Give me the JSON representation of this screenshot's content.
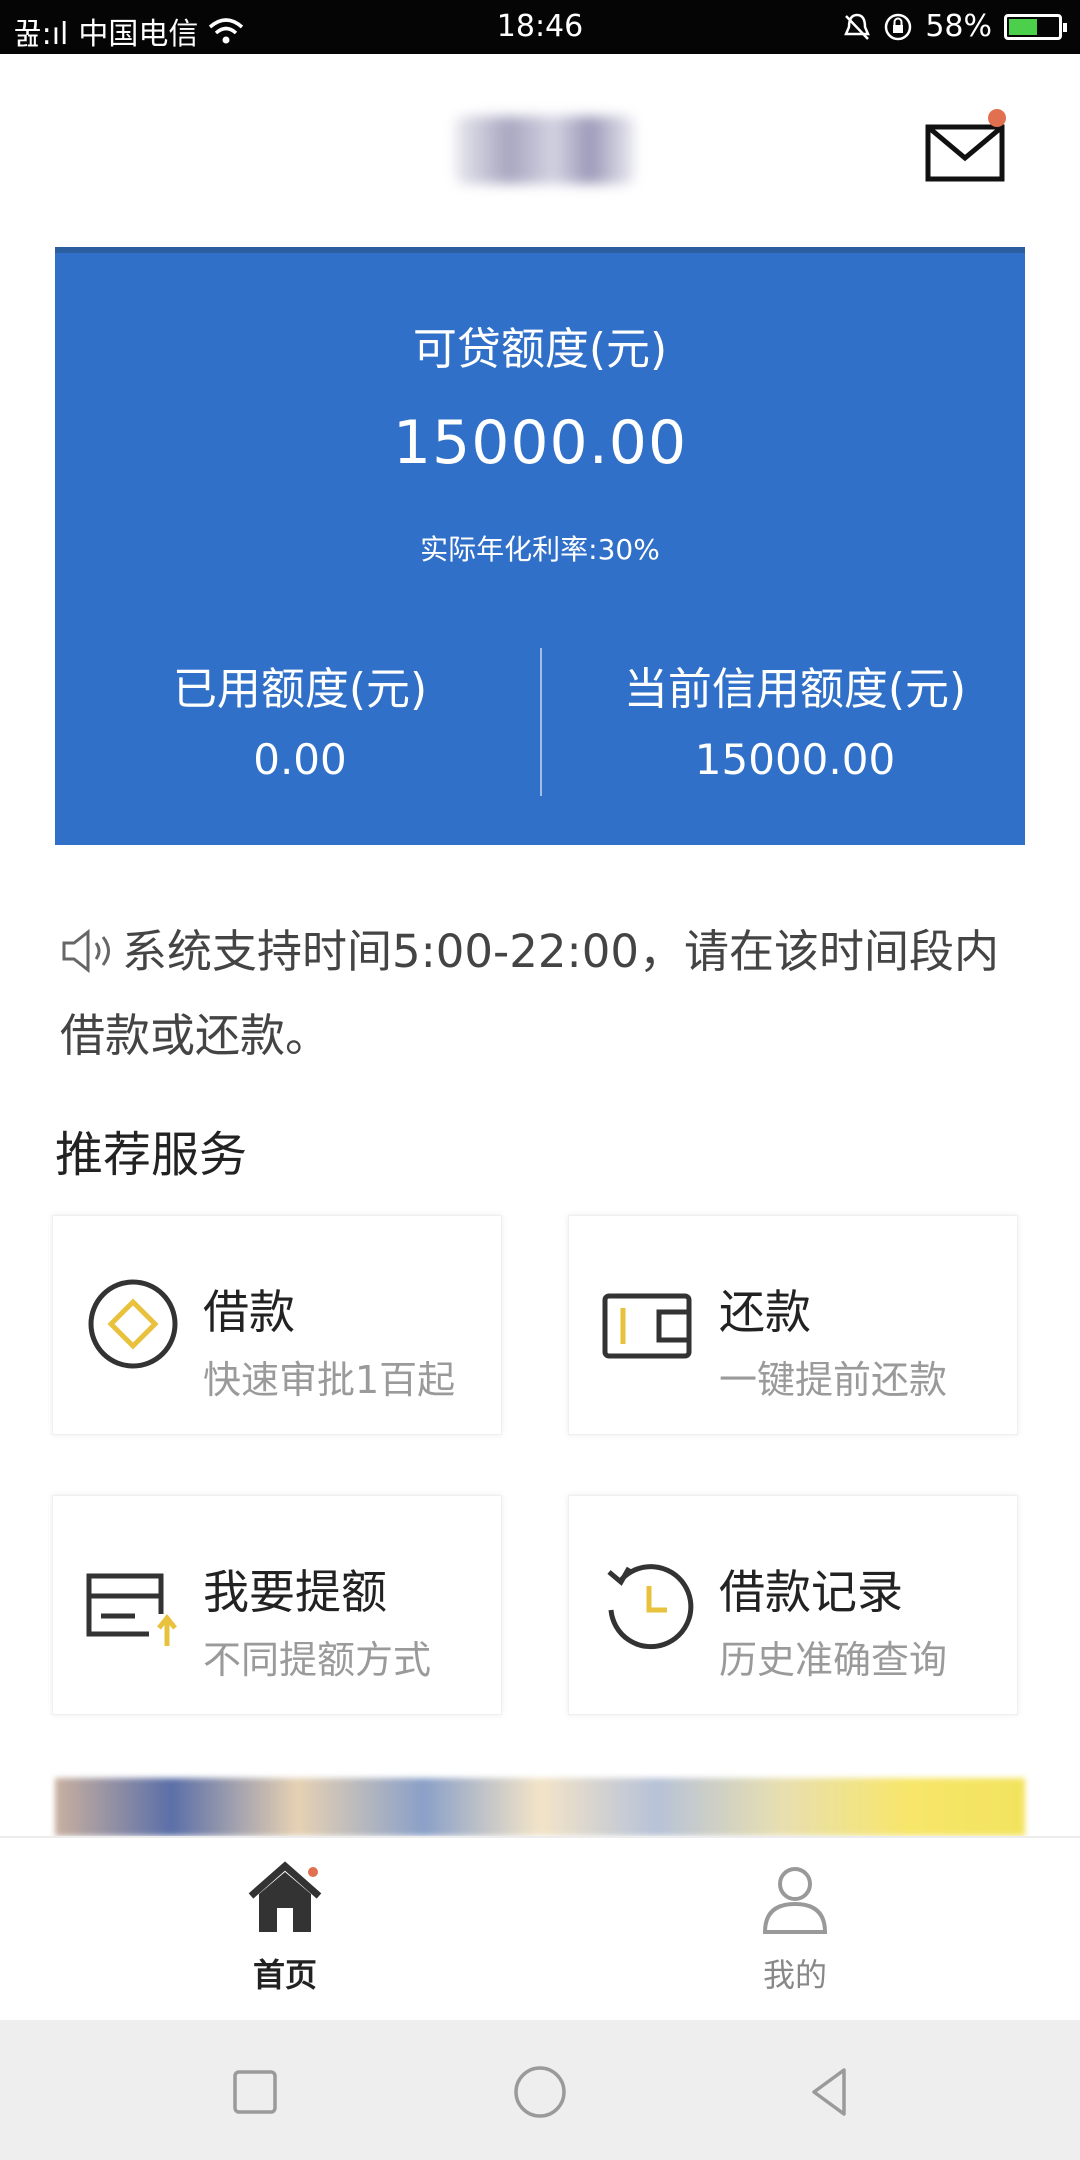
{
  "status_bar": {
    "signal_text": "꿆:ıl",
    "carrier": "中国电信",
    "time": "18:46",
    "battery_percent": "58%",
    "battery_level": 0.58,
    "icons": [
      "signal-icon",
      "wifi-icon",
      "alarm-icon",
      "rotation-lock-icon",
      "battery-icon"
    ]
  },
  "header": {
    "mail_icon": "mail-icon",
    "has_unread": true
  },
  "credit_card": {
    "available_label": "可贷额度(元)",
    "available_amount": "15000.00",
    "rate_text": "实际年化利率:30%",
    "used_label": "已用额度(元)",
    "used_amount": "0.00",
    "current_label": "当前信用额度(元)",
    "current_amount": "15000.00",
    "background_color": "#3070c8"
  },
  "notice": {
    "text": "系统支持时间5:00-22:00，请在该时间段内借款或还款。",
    "icon": "speaker-icon"
  },
  "services": {
    "title": "推荐服务",
    "items": [
      {
        "title": "借款",
        "subtitle": "快速审批1百起",
        "icon": "coin-icon"
      },
      {
        "title": "还款",
        "subtitle": "一键提前还款",
        "icon": "wallet-icon"
      },
      {
        "title": "我要提额",
        "subtitle": "不同提额方式",
        "icon": "raise-limit-icon"
      },
      {
        "title": "借款记录",
        "subtitle": "历史准确查询",
        "icon": "history-clock-icon"
      }
    ]
  },
  "bottom_nav": {
    "items": [
      {
        "label": "首页",
        "icon": "home-icon",
        "active": true
      },
      {
        "label": "我的",
        "icon": "user-icon",
        "active": false
      }
    ]
  },
  "system_nav": {
    "icons": [
      "recents-square-icon",
      "home-circle-icon",
      "back-triangle-icon"
    ]
  }
}
